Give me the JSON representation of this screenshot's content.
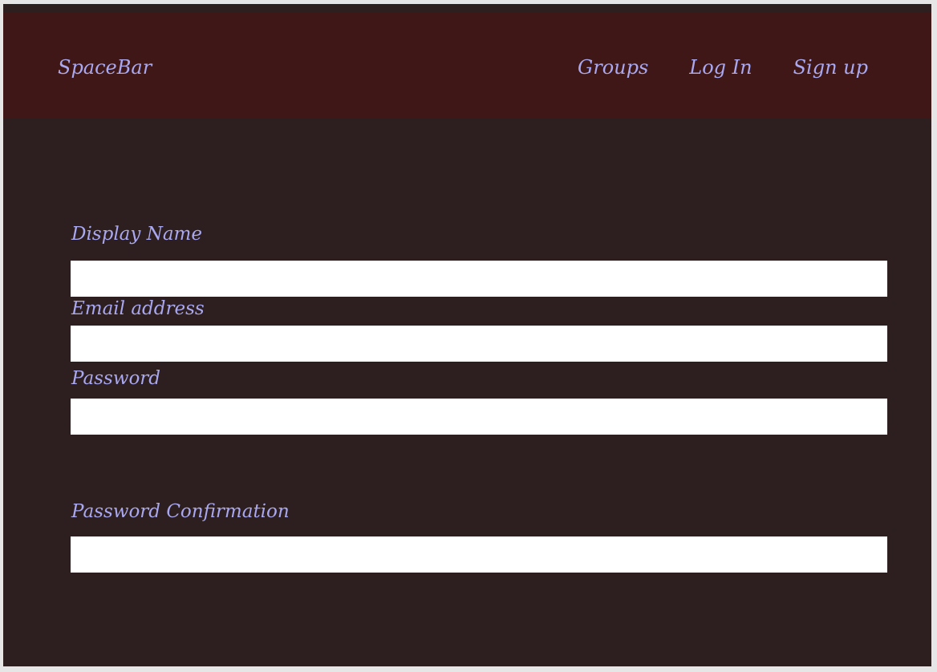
{
  "navbar": {
    "brand": "SpaceBar",
    "links": [
      {
        "label": "Groups"
      },
      {
        "label": "Log In"
      },
      {
        "label": "Sign up"
      }
    ],
    "background": "#3f1716",
    "text_color": "#a9a8f0"
  },
  "form": {
    "display_name": {
      "label": "Display Name",
      "value": "",
      "placeholder": ""
    },
    "email": {
      "label": "Email address",
      "value": "",
      "placeholder": ""
    },
    "password": {
      "label": "Password",
      "value": "",
      "placeholder": ""
    },
    "password_confirmation": {
      "label": "Password Confirmation",
      "value": "",
      "placeholder": ""
    }
  },
  "theme": {
    "page_background": "#2d1f1f",
    "input_background": "#ffffff"
  }
}
